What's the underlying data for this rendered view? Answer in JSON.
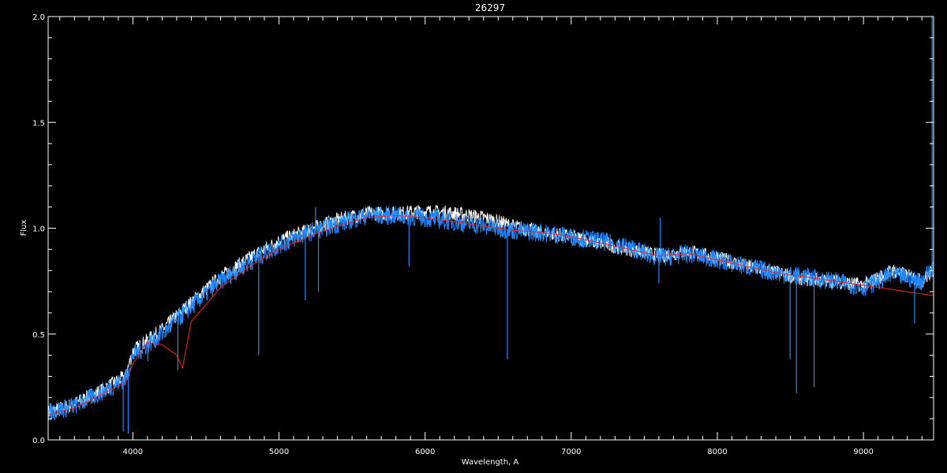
{
  "chart_data": {
    "type": "line",
    "title": "26297",
    "xlabel": "Wavelength, A",
    "ylabel": "Flux",
    "xlim": [
      3420,
      9480
    ],
    "ylim": [
      0.0,
      2.0
    ],
    "x_ticks": [
      4000,
      5000,
      6000,
      7000,
      8000,
      9000
    ],
    "x_tick_labels": [
      "4000",
      "5000",
      "6000",
      "7000",
      "8000",
      "9000"
    ],
    "y_ticks": [
      0.0,
      0.5,
      1.0,
      1.5,
      2.0
    ],
    "y_tick_labels": [
      "0.0",
      "0.5",
      "1.0",
      "1.5",
      "2.0"
    ],
    "grid": false,
    "background": "#000000",
    "axis_color": "#ffffff",
    "series": [
      {
        "color": "#ffffff",
        "x": [
          3420,
          3600,
          3800,
          3950,
          4000,
          4200,
          4400,
          4600,
          4800,
          5000,
          5200,
          5400,
          5600,
          5800,
          6000,
          6200,
          6400,
          6600,
          6800,
          7000,
          7200,
          7400,
          7600,
          7800,
          8000,
          8200,
          8400,
          8600,
          8800,
          9000,
          9200,
          9400,
          9480
        ],
        "y": [
          0.13,
          0.17,
          0.24,
          0.3,
          0.42,
          0.52,
          0.65,
          0.77,
          0.86,
          0.94,
          0.99,
          1.04,
          1.07,
          1.07,
          1.08,
          1.07,
          1.05,
          1.01,
          0.98,
          0.96,
          0.93,
          0.9,
          0.87,
          0.89,
          0.86,
          0.82,
          0.79,
          0.76,
          0.75,
          0.73,
          0.8,
          0.75,
          0.8
        ]
      },
      {
        "color": "#1e88ff",
        "x": [
          3420,
          3600,
          3800,
          3950,
          4000,
          4200,
          4400,
          4600,
          4800,
          5000,
          5200,
          5400,
          5600,
          5800,
          6000,
          6200,
          6400,
          6600,
          6800,
          7000,
          7200,
          7400,
          7600,
          7800,
          8000,
          8200,
          8400,
          8600,
          8800,
          9000,
          9200,
          9400,
          9480
        ],
        "y": [
          0.13,
          0.16,
          0.23,
          0.29,
          0.4,
          0.5,
          0.63,
          0.75,
          0.84,
          0.92,
          0.98,
          1.02,
          1.06,
          1.06,
          1.05,
          1.03,
          1.01,
          0.99,
          0.98,
          0.96,
          0.94,
          0.91,
          0.86,
          0.88,
          0.85,
          0.82,
          0.79,
          0.77,
          0.75,
          0.72,
          0.78,
          0.75,
          0.82
        ]
      },
      {
        "color": "#ff2020",
        "x": [
          3420,
          3600,
          3800,
          3950,
          4000,
          4100,
          4200,
          4300,
          4340,
          4400,
          4600,
          4800,
          5000,
          5200,
          5400,
          5600,
          5800,
          6000,
          6200,
          6400,
          6600,
          6800,
          7000,
          7200,
          7400,
          7600,
          7800,
          8000,
          8200,
          8400,
          8600,
          8800,
          9000,
          9200,
          9400,
          9600
        ],
        "y": [
          0.12,
          0.15,
          0.22,
          0.27,
          0.36,
          0.46,
          0.45,
          0.4,
          0.34,
          0.56,
          0.72,
          0.82,
          0.9,
          0.96,
          1.01,
          1.05,
          1.06,
          1.05,
          1.03,
          1.01,
          0.99,
          0.98,
          0.96,
          0.93,
          0.9,
          0.87,
          0.88,
          0.85,
          0.82,
          0.79,
          0.77,
          0.75,
          0.73,
          0.71,
          0.69,
          0.67
        ]
      }
    ],
    "absorption_lines": [
      {
        "x": 3934,
        "depth_to": 0.04
      },
      {
        "x": 3968,
        "depth_to": 0.03
      },
      {
        "x": 4102,
        "depth_to": 0.37
      },
      {
        "x": 4308,
        "depth_to": 0.33
      },
      {
        "x": 4861,
        "depth_to": 0.4
      },
      {
        "x": 5180,
        "depth_to": 0.66
      },
      {
        "x": 5270,
        "depth_to": 0.7
      },
      {
        "x": 5890,
        "depth_to": 0.82
      },
      {
        "x": 6563,
        "depth_to": 0.38
      },
      {
        "x": 7600,
        "depth_to": 0.74
      },
      {
        "x": 8498,
        "depth_to": 0.38
      },
      {
        "x": 8542,
        "depth_to": 0.22
      },
      {
        "x": 8662,
        "depth_to": 0.25
      },
      {
        "x": 9350,
        "depth_to": 0.55
      }
    ],
    "emission_spikes": [
      {
        "x": 5250,
        "height_to": 1.1
      },
      {
        "x": 7610,
        "height_to": 1.05
      },
      {
        "x": 9470,
        "height_to": 2.0
      }
    ]
  }
}
